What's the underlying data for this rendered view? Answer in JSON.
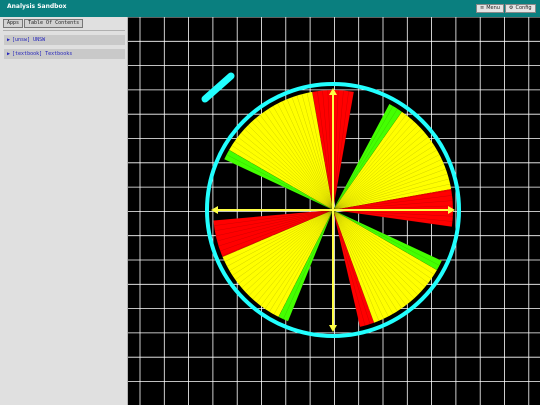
{
  "app": {
    "title": "Analysis Sandbox"
  },
  "header": {
    "buttons": [
      {
        "icon": "menu-icon",
        "glyph": "≡",
        "label": "Menu"
      },
      {
        "icon": "config-icon",
        "glyph": "⚙",
        "label": "Config"
      }
    ]
  },
  "sidebar": {
    "tabs": [
      {
        "label": "Apps"
      },
      {
        "label": "Table Of Contents"
      }
    ],
    "items": [
      {
        "arrow": "▶",
        "label": "[unsw] UNSW"
      },
      {
        "arrow": "▶",
        "label": "[textbook] Textbooks"
      }
    ]
  },
  "canvas": {
    "background": "#000000",
    "grid_color": "#ffffff",
    "circle_color": "#22ffff",
    "axis_color": "#ffff44",
    "pen_stroke_color": "#22ffff",
    "sectors": [
      {
        "color": "#ff0000",
        "start_deg": 80,
        "end_deg": 100
      },
      {
        "color": "#ffff00",
        "start_deg": 100,
        "end_deg": 150
      },
      {
        "color": "#44ff00",
        "start_deg": 150,
        "end_deg": 155
      },
      {
        "color": "#ffff00",
        "start_deg": 10,
        "end_deg": 55
      },
      {
        "color": "#44ff00",
        "start_deg": 55,
        "end_deg": 62
      },
      {
        "color": "#ff0000",
        "start_deg": -8,
        "end_deg": 10
      },
      {
        "color": "#ff0000",
        "start_deg": 185,
        "end_deg": 203
      },
      {
        "color": "#ffff00",
        "start_deg": 203,
        "end_deg": 243
      },
      {
        "color": "#44ff00",
        "start_deg": 243,
        "end_deg": 248
      },
      {
        "color": "#ff0000",
        "start_deg": 283,
        "end_deg": 290
      },
      {
        "color": "#ffff00",
        "start_deg": 290,
        "end_deg": 330
      },
      {
        "color": "#44ff00",
        "start_deg": 330,
        "end_deg": 335
      }
    ]
  }
}
